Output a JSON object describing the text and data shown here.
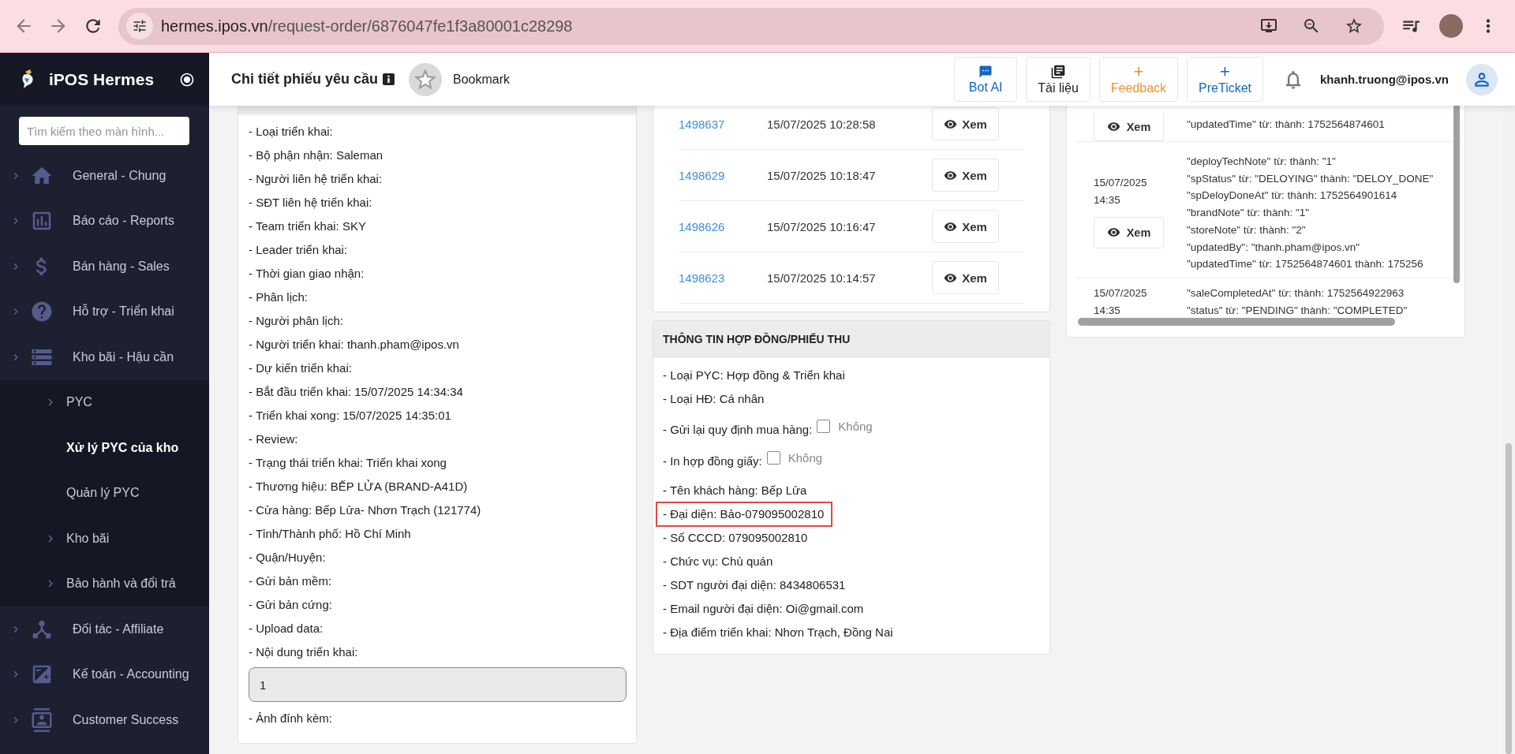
{
  "browser": {
    "url_host": "hermes.ipos.vn",
    "url_path": "/request-order/6876047fe1f3a80001c28298"
  },
  "sidebar": {
    "title": "iPOS Hermes",
    "search_placeholder": "Tìm kiếm theo màn hình...",
    "items": [
      {
        "label": "General - Chung",
        "kind": "home",
        "selected": false
      },
      {
        "label": "Báo cáo - Reports",
        "kind": "chart",
        "selected": false
      },
      {
        "label": "Bán hàng - Sales",
        "kind": "dollar",
        "selected": false
      },
      {
        "label": "Hỗ trợ - Triển khai",
        "kind": "help",
        "selected": false
      },
      {
        "label": "Kho bãi - Hậu cần",
        "kind": "storage",
        "selected": false,
        "children": [
          {
            "label": "PYC",
            "expandable": true,
            "selected": false
          },
          {
            "label": "Xử lý PYC của kho",
            "expandable": false,
            "selected": true
          },
          {
            "label": "Quản lý PYC",
            "expandable": false,
            "selected": false
          },
          {
            "label": "Kho bãi",
            "expandable": true,
            "selected": false
          },
          {
            "label": "Bảo hành và đổi trả",
            "expandable": true,
            "selected": false
          }
        ]
      },
      {
        "label": "Đối tác - Affiliate",
        "kind": "hub",
        "selected": false
      },
      {
        "label": "Kế toán - Accounting",
        "kind": "accounting",
        "selected": false
      },
      {
        "label": "Customer Success",
        "kind": "contact",
        "selected": false
      }
    ]
  },
  "header": {
    "title": "Chi tiết phiếu yêu cầu",
    "bookmark": "Bookmark",
    "buttons": [
      {
        "label": "Bot AI",
        "kind": "chat",
        "color": "#1565c0"
      },
      {
        "label": "Tài liệu",
        "kind": "books",
        "color": "#222222"
      },
      {
        "label": "Feedback",
        "kind": "plus",
        "symbol": "+",
        "color": "#f0932b"
      },
      {
        "label": "PreTicket",
        "kind": "plus",
        "symbol": "+",
        "color": "#1565c0"
      }
    ],
    "user": "khanh.truong@ipos.vn"
  },
  "deployment_info": {
    "items": [
      {
        "kind": "line",
        "text": "- Loại triển khai:"
      },
      {
        "kind": "line",
        "text": "- Bộ phận nhận: Saleman"
      },
      {
        "kind": "line",
        "text": "- Người liên hệ triển khai:"
      },
      {
        "kind": "line",
        "text": "- SĐT liên hệ triển khai:"
      },
      {
        "kind": "line",
        "text": "- Team triển khai: SKY"
      },
      {
        "kind": "line",
        "text": "- Leader triển khai:"
      },
      {
        "kind": "line",
        "text": "- Thời gian giao nhận:"
      },
      {
        "kind": "line",
        "text": "- Phân lịch:"
      },
      {
        "kind": "line",
        "text": "- Người phân lịch:"
      },
      {
        "kind": "line",
        "text": "- Người triển khai: thanh.pham@ipos.vn"
      },
      {
        "kind": "line",
        "text": "- Dự kiến triển khai:"
      },
      {
        "kind": "line",
        "text": "- Bắt đầu triển khai: 15/07/2025 14:34:34"
      },
      {
        "kind": "line",
        "text": "- Triển khai xong: 15/07/2025 14:35:01"
      },
      {
        "kind": "line",
        "text": "- Review:"
      },
      {
        "kind": "line",
        "text": "- Trạng thái triển khai: Triển khai xong"
      },
      {
        "kind": "line",
        "text": "- Thương hiệu: BẾP LỬA (BRAND-A41D)"
      },
      {
        "kind": "line",
        "text": "- Cửa hàng: Bếp Lửa- Nhơn Trạch (121774)"
      },
      {
        "kind": "line",
        "text": "- Tỉnh/Thành phố: Hồ Chí Minh"
      },
      {
        "kind": "line",
        "text": "- Quận/Huyện:"
      },
      {
        "kind": "line",
        "text": "- Gửi bản mềm:"
      },
      {
        "kind": "line",
        "text": "- Gửi bản cứng:"
      },
      {
        "kind": "line",
        "text": "- Upload data:"
      },
      {
        "kind": "line",
        "text": "- Nội dung triển khai:"
      },
      {
        "kind": "textbox",
        "value": "1"
      },
      {
        "kind": "line",
        "text": "- Ảnh đính kèm:"
      }
    ]
  },
  "history": {
    "rows": [
      {
        "id": "1498637",
        "time": "15/07/2025 10:28:58",
        "action": "Xem"
      },
      {
        "id": "1498629",
        "time": "15/07/2025 10:18:47",
        "action": "Xem"
      },
      {
        "id": "1498626",
        "time": "15/07/2025 10:16:47",
        "action": "Xem"
      },
      {
        "id": "1498623",
        "time": "15/07/2025 10:14:57",
        "action": "Xem"
      }
    ]
  },
  "contract": {
    "title": "THÔNG TIN HỢP ĐỒNG/PHIẾU THU",
    "items": [
      {
        "kind": "line",
        "text": "- Loại PYC: Hợp đồng & Triển khai",
        "highlighted": false
      },
      {
        "kind": "line",
        "text": "- Loại HĐ: Cá nhân",
        "highlighted": false
      },
      {
        "kind": "checkbox",
        "label": "- Gửi lại quy định mua hàng:",
        "checked": false,
        "value": "Không"
      },
      {
        "kind": "checkbox",
        "label": "- In hợp đồng giấy:",
        "checked": false,
        "value": "Không"
      },
      {
        "kind": "line",
        "text": "- Tên khách hàng: Bếp Lửa",
        "highlighted": false
      },
      {
        "kind": "line",
        "text": "- Đại diện: Bảo-079095002810",
        "highlighted": true
      },
      {
        "kind": "line",
        "text": "- Số CCCD: 079095002810",
        "highlighted": false
      },
      {
        "kind": "line",
        "text": "- Chức vụ: Chủ quán",
        "highlighted": false
      },
      {
        "kind": "line",
        "text": "- SDT người đại diện: 8434806531",
        "highlighted": false
      },
      {
        "kind": "line",
        "text": "- Email người đại diện: Oi@gmail.com",
        "highlighted": false
      },
      {
        "kind": "line",
        "text": "- Địa điểm triển khai: Nhơn Trạch, Đồng Nai",
        "highlighted": false
      }
    ]
  },
  "changes": {
    "rows": [
      {
        "action": "Xem",
        "changes": [
          "\"updatedTime\" từ: thành: 1752564874601"
        ]
      },
      {
        "date": "15/07/2025",
        "time": "14:35",
        "action": "Xem",
        "changes": [
          "\"deployTechNote\" từ: thành: \"1\"",
          "\"spStatus\" từ: \"DELOYING\" thành: \"DELOY_DONE\"",
          "\"spDeloyDoneAt\" từ: thành: 1752564901614",
          "\"brandNote\" từ: thành: \"1\"",
          "\"storeNote\" từ: thành: \"2\"",
          "\"updatedBy\": \"thanh.pham@ipos.vn\"",
          "\"updatedTime\" từ: 1752564874601 thành: 175256"
        ]
      },
      {
        "date": "15/07/2025",
        "time": "14:35",
        "changes": [
          "\"saleCompletedAt\" từ: thành: 1752564922963",
          "\"status\" từ: \"PENDING\" thành: \"COMPLETED\""
        ]
      }
    ]
  }
}
